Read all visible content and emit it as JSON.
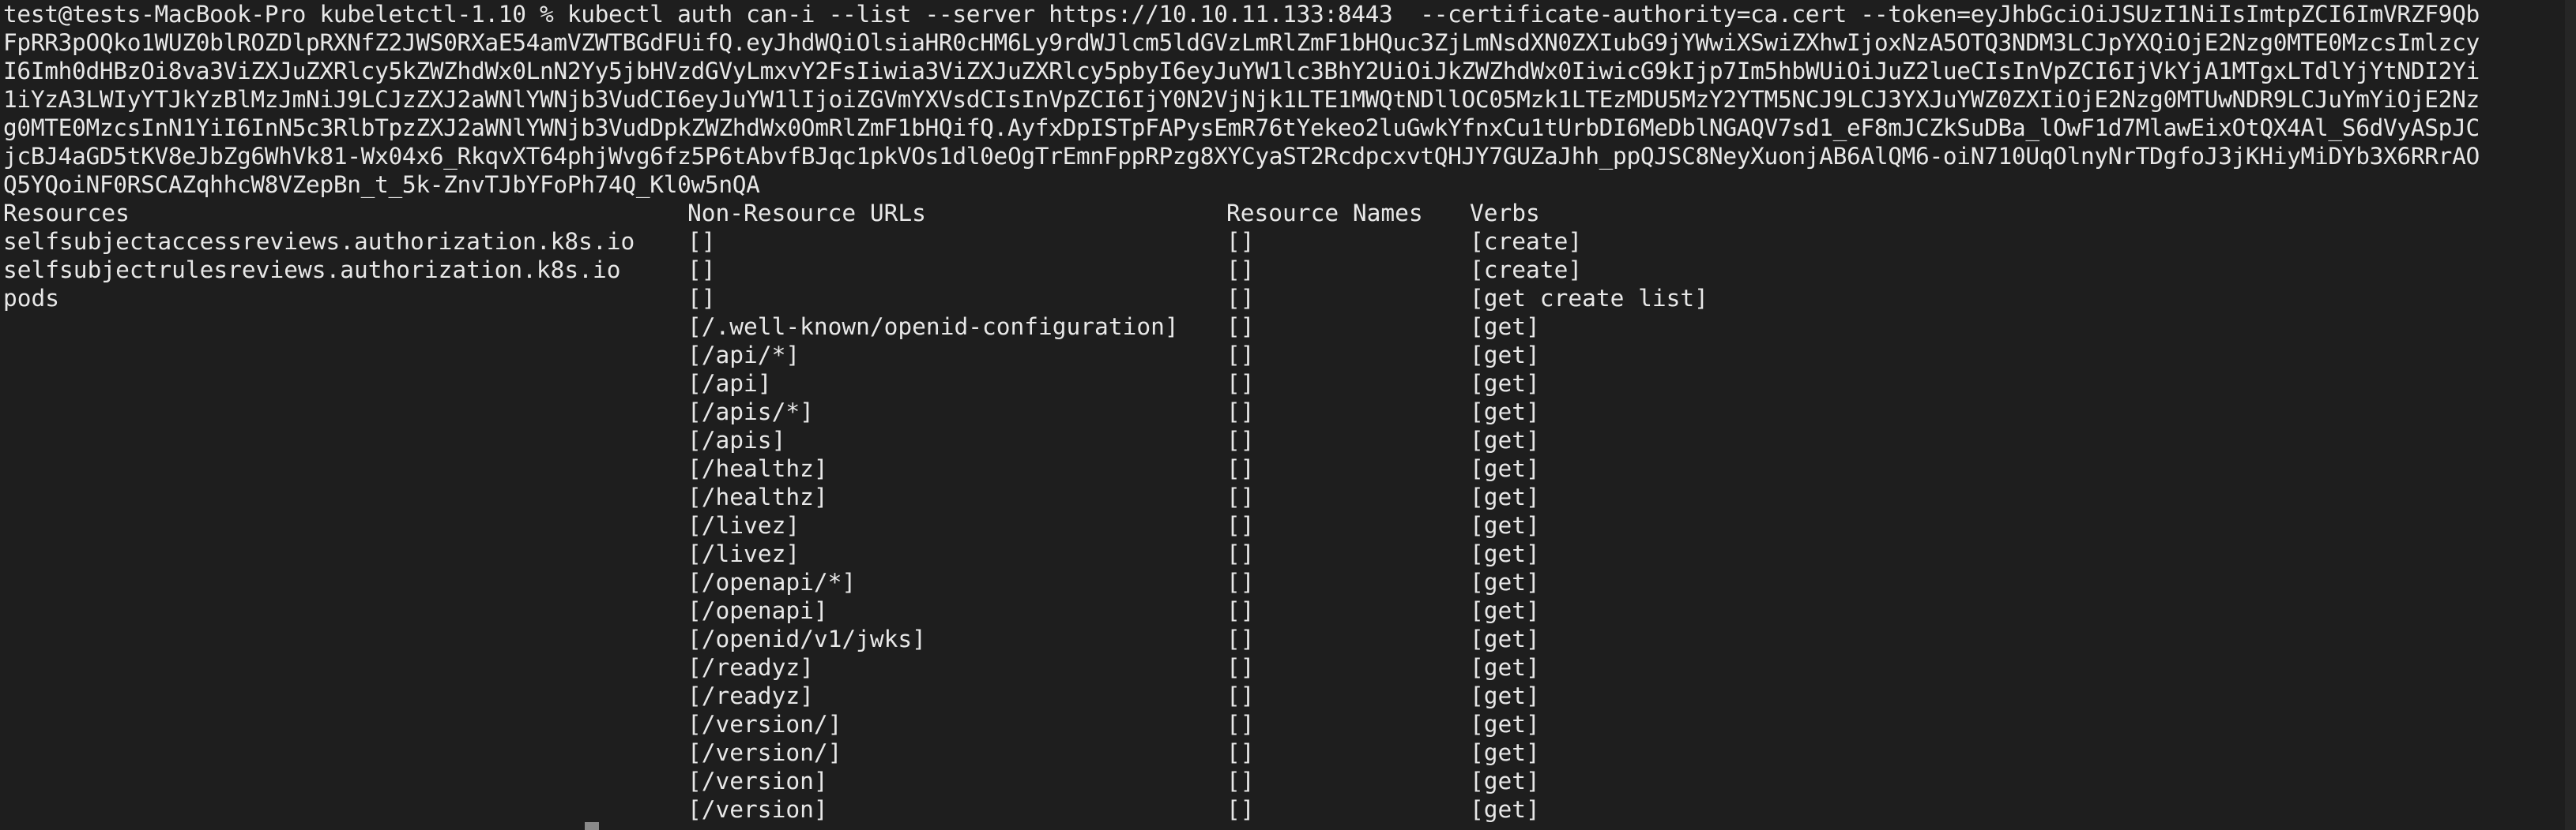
{
  "terminal": {
    "command_lines": [
      "test@tests-MacBook-Pro kubeletctl-1.10 % kubectl auth can-i --list --server https://10.10.11.133:8443  --certificate-authority=ca.cert --token=eyJhbGciOiJSUzI1NiIsImtpZCI6ImVRZF9Qb",
      "FpRR3pOQko1WUZ0blROZDlpRXNfZ2JWS0RXaE54amVZWTBGdFUifQ.eyJhdWQiOlsiaHR0cHM6Ly9rdWJlcm5ldGVzLmRlZmF1bHQuc3ZjLmNsdXN0ZXIubG9jYWwiXSwiZXhwIjoxNzA5OTQ3NDM3LCJpYXQiOjE2Nzg0MTE0MzcsImlzcy",
      "I6Imh0dHBzOi8va3ViZXJuZXRlcy5kZWZhdWx0LnN2Yy5jbHVzdGVyLmxvY2FsIiwia3ViZXJuZXRlcy5pbyI6eyJuYW1lc3BhY2UiOiJkZWZhdWx0IiwicG9kIjp7Im5hbWUiOiJuZ2lueCIsInVpZCI6IjVkYjA1MTgxLTdlYjYtNDI2Yi",
      "1iYzA3LWIyYTJkYzBlMzJmNiJ9LCJzZXJ2aWNlYWNjb3VudCI6eyJuYW1lIjoiZGVmYXVsdCIsInVpZCI6IjY0N2VjNjk1LTE1MWQtNDllOC05Mzk1LTEzMDU5MzY2YTM5NCJ9LCJ3YXJuYWZ0ZXIiOjE2Nzg0MTUwNDR9LCJuYmYiOjE2Nz",
      "g0MTE0MzcsInN1YiI6InN5c3RlbTpzZXJ2aWNlYWNjb3VudDpkZWZhdWx0OmRlZmF1bHQifQ.AyfxDpISTpFAPysEmR76tYekeo2luGwkYfnxCu1tUrbDI6MeDblNGAQV7sd1_eF8mJCZkSuDBa_lOwF1d7MlawEixOtQX4Al_S6dVyASpJC",
      "jcBJ4aGD5tKV8eJbZg6WhVk81-Wx04x6_RkqvXT64phjWvg6fz5P6tAbvfBJqc1pkVOs1dl0eOgTrEmnFppRPzg8XYCyaST2RcdpcxvtQHJY7GUZaJhh_ppQJSC8NeyXuonjAB6AlQM6-oiN710UqOlnyNrTDgfoJ3jKHiyMiDYb3X6RRrAO",
      "Q5YQoiNF0RSCAZqhhcW8VZepBn_t_5k-ZnvTJbYFoPh74Q_Kl0w5nQA"
    ],
    "table": {
      "headers": [
        "Resources",
        "Non-Resource URLs",
        "Resource Names",
        "Verbs"
      ],
      "rows": [
        [
          "selfsubjectaccessreviews.authorization.k8s.io",
          "[]",
          "[]",
          "[create]"
        ],
        [
          "selfsubjectrulesreviews.authorization.k8s.io",
          "[]",
          "[]",
          "[create]"
        ],
        [
          "pods",
          "[]",
          "[]",
          "[get create list]"
        ],
        [
          "",
          "[/.well-known/openid-configuration]",
          "[]",
          "[get]"
        ],
        [
          "",
          "[/api/*]",
          "[]",
          "[get]"
        ],
        [
          "",
          "[/api]",
          "[]",
          "[get]"
        ],
        [
          "",
          "[/apis/*]",
          "[]",
          "[get]"
        ],
        [
          "",
          "[/apis]",
          "[]",
          "[get]"
        ],
        [
          "",
          "[/healthz]",
          "[]",
          "[get]"
        ],
        [
          "",
          "[/healthz]",
          "[]",
          "[get]"
        ],
        [
          "",
          "[/livez]",
          "[]",
          "[get]"
        ],
        [
          "",
          "[/livez]",
          "[]",
          "[get]"
        ],
        [
          "",
          "[/openapi/*]",
          "[]",
          "[get]"
        ],
        [
          "",
          "[/openapi]",
          "[]",
          "[get]"
        ],
        [
          "",
          "[/openid/v1/jwks]",
          "[]",
          "[get]"
        ],
        [
          "",
          "[/readyz]",
          "[]",
          "[get]"
        ],
        [
          "",
          "[/readyz]",
          "[]",
          "[get]"
        ],
        [
          "",
          "[/version/]",
          "[]",
          "[get]"
        ],
        [
          "",
          "[/version/]",
          "[]",
          "[get]"
        ],
        [
          "",
          "[/version]",
          "[]",
          "[get]"
        ],
        [
          "",
          "[/version]",
          "[]",
          "[get]"
        ]
      ]
    }
  },
  "colors": {
    "background": "#1e1e1e",
    "text": "#e8e8e8"
  }
}
